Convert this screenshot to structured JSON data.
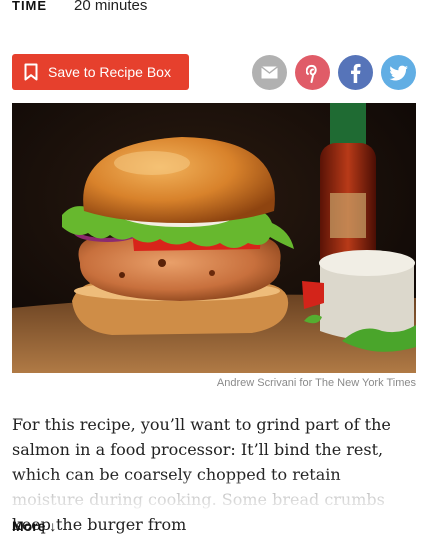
{
  "time": {
    "label": "TIME",
    "value": "20 minutes"
  },
  "save_button": {
    "label": "Save to Recipe Box",
    "icon": "bookmark-icon"
  },
  "share_buttons": [
    {
      "name": "email",
      "icon": "envelope-icon",
      "color": "#b1b1b1"
    },
    {
      "name": "pinterest",
      "icon": "pinterest-icon",
      "color": "#e05c68"
    },
    {
      "name": "facebook",
      "icon": "facebook-icon",
      "color": "#5674b9"
    },
    {
      "name": "twitter",
      "icon": "twitter-icon",
      "color": "#61aee4"
    }
  ],
  "photo": {
    "credit": "Andrew Scrivani for The New York Times"
  },
  "description": "For this recipe, you’ll want to grind part of the salmon in a food processor: It’ll bind the rest, which can be coarsely chopped to retain moisture during cooking. Some bread crumbs keep the burger from",
  "more_link": "More ↓",
  "colors": {
    "accent": "#e6402d"
  }
}
